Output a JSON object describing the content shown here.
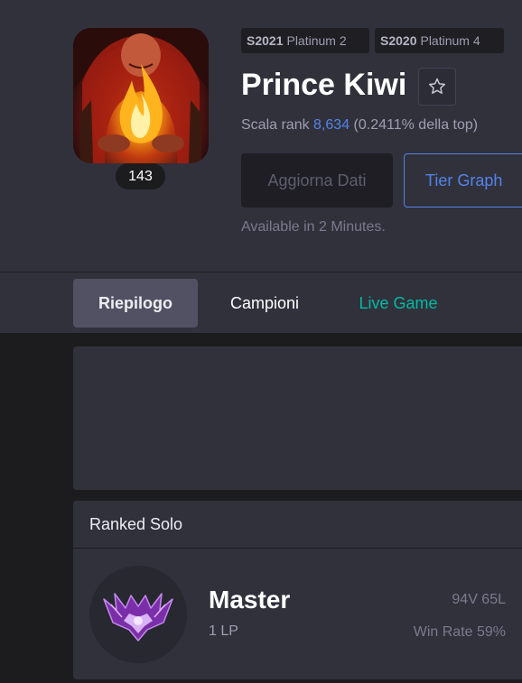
{
  "profile": {
    "name": "Prince Kiwi",
    "level": "143",
    "icon": "fire-mage-portrait-icon"
  },
  "past_ranks": [
    {
      "season": "S2021",
      "tier": "Platinum 2"
    },
    {
      "season": "S2020",
      "tier": "Platinum 4"
    }
  ],
  "ladder": {
    "prefix": "Scala rank ",
    "rank": "8,634",
    "suffix": " (0.2411% della top)"
  },
  "actions": {
    "update_label": "Aggiorna Dati",
    "tier_graph_label": "Tier Graph",
    "available_text": "Available in 2 Minutes.",
    "favorite_icon": "star-outline-icon"
  },
  "tabs": [
    {
      "label": "Riepilogo",
      "active": true
    },
    {
      "label": "Campioni",
      "active": false
    },
    {
      "label": "Live Game",
      "active": false
    }
  ],
  "ranked_solo": {
    "title": "Ranked Solo",
    "tier": "Master",
    "lp": "1 LP",
    "record": "94V 65L",
    "win_rate": "Win Rate 59%",
    "emblem_icon": "master-emblem-icon"
  },
  "colors": {
    "accent_blue": "#5383e8",
    "live_green": "#00bba3",
    "background": "#1c1c1f",
    "panel": "#31313c",
    "master_purple": "#9e3fd1"
  }
}
